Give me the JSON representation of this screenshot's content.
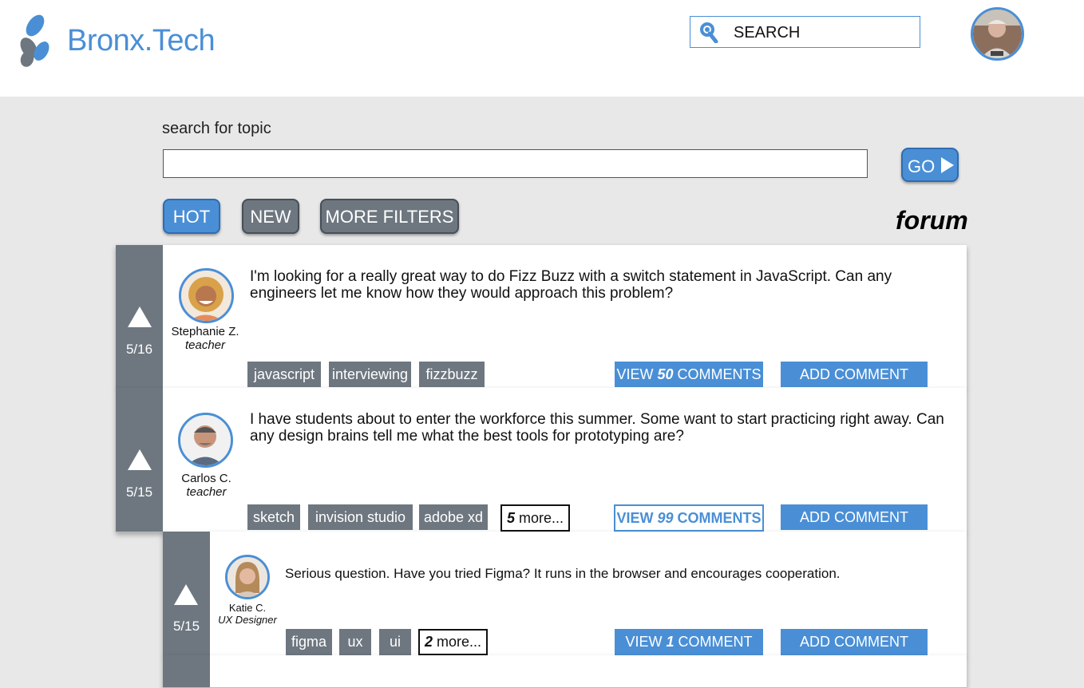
{
  "header": {
    "brand": "Bronx.Tech",
    "search_label": "SEARCH"
  },
  "topic_search": {
    "label": "search for topic",
    "value": "",
    "go_label": "GO"
  },
  "filters": {
    "hot": "HOT",
    "new": "NEW",
    "more": "MORE FILTERS"
  },
  "page_title": "forum",
  "colors": {
    "accent": "#4a8fd6",
    "gray": "#6e7780",
    "background": "#e8e8e8"
  },
  "posts": [
    {
      "date": "5/16",
      "author": "Stephanie Z.",
      "role": "teacher",
      "text": "I'm looking for a really great way to do Fizz Buzz with a switch statement in JavaScript. Can any engineers let me know how they would approach this problem?",
      "tags": [
        "javascript",
        "interviewing",
        "fizzbuzz"
      ],
      "comments_prefix": "VIEW ",
      "comments_count": "50",
      "comments_suffix": " COMMENTS",
      "add_comment": "ADD COMMENT"
    },
    {
      "date": "5/15",
      "author": "Carlos C.",
      "role": "teacher",
      "text": "I have students about to enter the workforce this summer. Some want to start practicing right away. Can any design brains tell me what the best tools for prototyping are?",
      "tags": [
        "sketch",
        "invision studio",
        "adobe xd"
      ],
      "more_count": "5",
      "more_label": " more...",
      "comments_prefix": "VIEW ",
      "comments_count": "99",
      "comments_suffix": " COMMENTS",
      "add_comment": "ADD COMMENT"
    },
    {
      "date": "5/15",
      "author": "Katie C.",
      "role": "UX Designer",
      "text": "Serious question. Have you tried Figma? It runs in the browser and encourages cooperation.",
      "tags": [
        "figma",
        "ux",
        "ui"
      ],
      "more_count": "2",
      "more_label": " more...",
      "comments_prefix": "VIEW ",
      "comments_count": "1",
      "comments_suffix": " COMMENT",
      "add_comment": "ADD COMMENT"
    }
  ]
}
